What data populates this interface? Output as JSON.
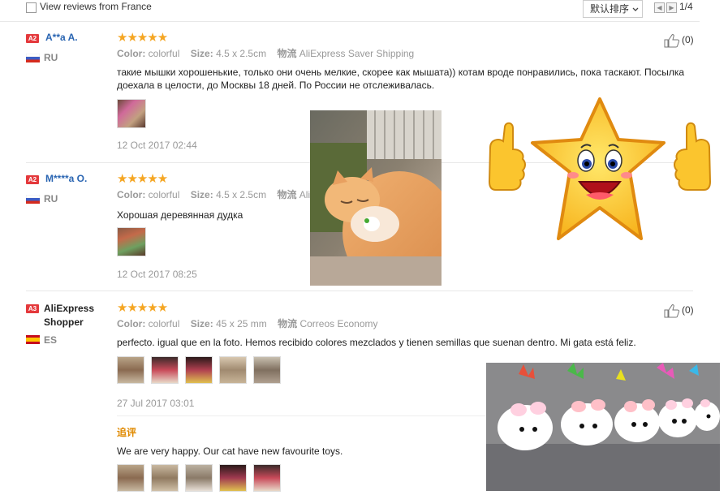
{
  "topbar": {
    "filter_label": "View reviews from France",
    "sort_label": "默认排序",
    "sort_chevron_icon": "chevron-down-icon",
    "prev_icon": "prev-page-icon",
    "next_icon": "next-page-icon",
    "pagination": "1/4"
  },
  "reviews": [
    {
      "level": "A2",
      "name": "A**a A.",
      "country": "RU",
      "stars": "★★★★★",
      "color_label": "Color:",
      "color_value": "colorful",
      "size_label": "Size:",
      "size_value": "4.5 x 2.5cm",
      "ship_label": "物流",
      "ship_value": "AliExpress Saver Shipping",
      "text": "такие мышки хорошенькие, только они очень мелкие, скорее как мышата)) котам вроде понравились, пока таскают. Посылка доехала в целости, до Москвы 18 дней. По России не отслеживалась.",
      "date": "12 Oct 2017 02:44",
      "likes": "(0)"
    },
    {
      "level": "A2",
      "name": "M****a O.",
      "country": "RU",
      "stars": "★★★★★",
      "color_label": "Color:",
      "color_value": "colorful",
      "size_label": "Size:",
      "size_value": "4.5 x 2.5cm",
      "ship_label": "物流",
      "ship_value": "AliE",
      "text": "Хорошая деревянная дудка",
      "date": "12 Oct 2017 08:25"
    },
    {
      "level": "A3",
      "name": "AliExpress Shopper",
      "country": "ES",
      "stars": "★★★★★",
      "color_label": "Color:",
      "color_value": "colorful",
      "size_label": "Size:",
      "size_value": "45 x 25 mm",
      "ship_label": "物流",
      "ship_value": "Correos Economy",
      "text": "perfecto. igual que en la foto. Hemos recibido colores mezclados y tienen semillas que suenan dentro. Mi gata está feliz.",
      "date": "27 Jul 2017 03:01",
      "likes": "(0)",
      "additional_label": "追评",
      "additional_text": "We are very happy. Our cat have new favourite toys."
    }
  ],
  "colors": {
    "accent_red": "#e4393c",
    "star_orange": "#f5a623",
    "link_blue": "#2a65b2",
    "followup_orange": "#e08a00"
  }
}
